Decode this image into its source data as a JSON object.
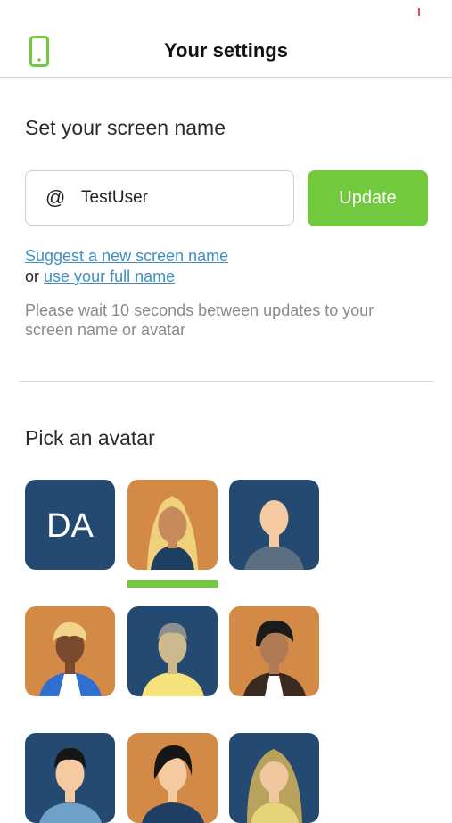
{
  "header": {
    "title": "Your settings",
    "icon": "phone-icon"
  },
  "screen_name": {
    "title": "Set your screen name",
    "at_symbol": "@",
    "value": "TestUser",
    "update_label": "Update",
    "suggest_link": "Suggest a new screen name",
    "or_text": "or",
    "full_name_link": "use your full name",
    "help_text": "Please wait 10 seconds between updates to your screen name or avatar"
  },
  "avatars": {
    "title": "Pick an avatar",
    "initials": "DA",
    "selected_index": 1
  },
  "colors": {
    "accent": "#72c93d",
    "link": "#3f8fc4",
    "avatar_blue": "#254a72",
    "avatar_orange": "#d28a46"
  }
}
